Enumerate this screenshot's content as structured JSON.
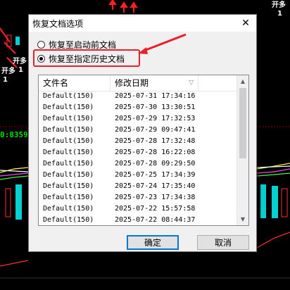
{
  "background": {
    "labels_top_right": [
      "开多",
      "1"
    ],
    "labels_left": [
      "开多",
      "1",
      "开多",
      "1"
    ],
    "green_readout": "0:8359"
  },
  "dialog": {
    "title": "恢复文档选项",
    "close_glyph": "✕",
    "options": [
      {
        "label": "恢复至启动前文档",
        "checked": false
      },
      {
        "label": "恢复至指定历史文档",
        "checked": true
      }
    ],
    "list": {
      "columns": [
        "文件名",
        "修改日期"
      ],
      "sort_glyph": "▽",
      "rows": [
        {
          "name": "Default(150)",
          "date": "2025-07-31  17:34:16"
        },
        {
          "name": "Default(150)",
          "date": "2025-07-30  13:30:51"
        },
        {
          "name": "Default(150)",
          "date": "2025-07-29  17:32:53"
        },
        {
          "name": "Default(150)",
          "date": "2025-07-29  09:47:41"
        },
        {
          "name": "Default(150)",
          "date": "2025-07-28  17:32:48"
        },
        {
          "name": "Default(150)",
          "date": "2025-07-28  16:22:08"
        },
        {
          "name": "Default(150)",
          "date": "2025-07-28  09:29:50"
        },
        {
          "name": "Default(150)",
          "date": "2025-07-25  17:34:39"
        },
        {
          "name": "Default(150)",
          "date": "2025-07-24  17:35:40"
        },
        {
          "name": "Default(150)",
          "date": "2025-07-23  17:34:38"
        },
        {
          "name": "Default(150)",
          "date": "2025-07-22  15:57:58"
        },
        {
          "name": "Default(150)",
          "date": "2025-07-22  08:44:37"
        }
      ]
    },
    "ok_label": "确定",
    "cancel_label": "取消",
    "highlight_color": "#e8202a"
  }
}
